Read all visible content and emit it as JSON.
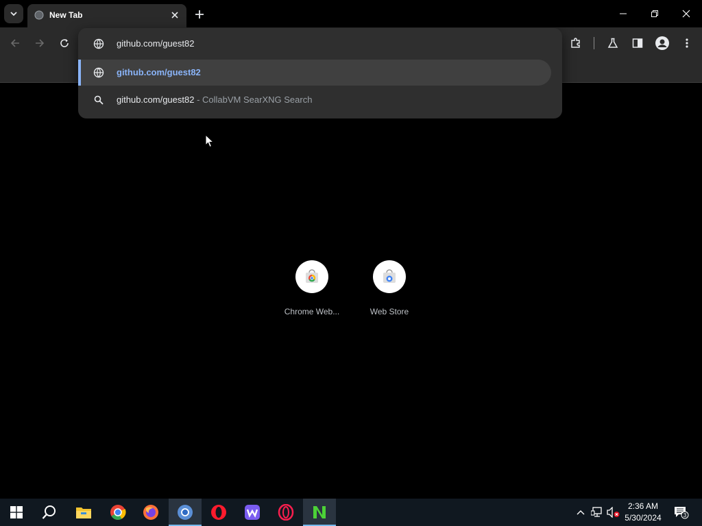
{
  "tab": {
    "title": "New Tab"
  },
  "omnibox": {
    "value": "github.com/guest82",
    "suggestions": [
      {
        "text": "github.com/guest82",
        "icon": "globe-icon"
      },
      {
        "text": "github.com/guest82",
        "suffix_sep": " - ",
        "suffix": "CollabVM SearXNG Search",
        "icon": "search-icon"
      }
    ]
  },
  "shortcuts": [
    {
      "label": "Chrome Web..."
    },
    {
      "label": "Web Store"
    }
  ],
  "taskbar": {
    "apps": [
      "start-icon",
      "search-icon",
      "file-explorer-icon",
      "chrome-icon",
      "firefox-icon",
      "chromium-icon",
      "opera-icon",
      "waterfox-icon",
      "opera-gx-icon",
      "notepad-icon"
    ]
  },
  "clock": {
    "time": "2:36 AM",
    "date": "5/30/2024"
  },
  "notifications": {
    "count": "3"
  },
  "colors": {
    "accent": "#8ab4f8",
    "taskbar": "#101820",
    "toolbar": "#2a2a2a"
  }
}
